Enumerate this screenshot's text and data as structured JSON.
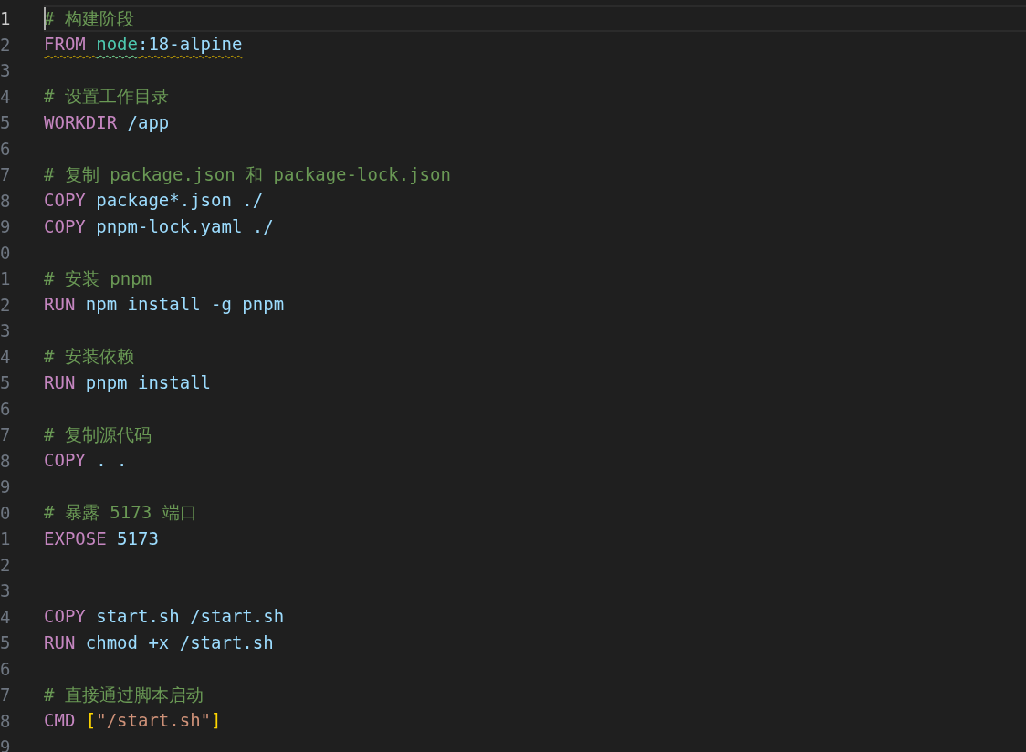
{
  "editor": {
    "lines": [
      {
        "number": "1",
        "current": true,
        "tokens": [
          {
            "kind": "comment",
            "text": "# 构建阶段"
          }
        ]
      },
      {
        "number": "2",
        "current": false,
        "warning": true,
        "tokens": [
          {
            "kind": "keyword",
            "text": "FROM "
          },
          {
            "kind": "image",
            "text": "node"
          },
          {
            "kind": "plain",
            "text": ":18-alpine"
          }
        ]
      },
      {
        "number": "3",
        "current": false
      },
      {
        "number": "4",
        "current": false,
        "tokens": [
          {
            "kind": "comment",
            "text": "# 设置工作目录"
          }
        ]
      },
      {
        "number": "5",
        "current": false,
        "tokens": [
          {
            "kind": "keyword",
            "text": "WORKDIR "
          },
          {
            "kind": "plain",
            "text": "/app"
          }
        ]
      },
      {
        "number": "6",
        "current": false
      },
      {
        "number": "7",
        "current": false,
        "tokens": [
          {
            "kind": "comment",
            "text": "# 复制 package.json 和 package-lock.json"
          }
        ]
      },
      {
        "number": "8",
        "current": false,
        "tokens": [
          {
            "kind": "keyword",
            "text": "COPY "
          },
          {
            "kind": "plain",
            "text": "package*.json ./"
          }
        ]
      },
      {
        "number": "9",
        "current": false,
        "tokens": [
          {
            "kind": "keyword",
            "text": "COPY "
          },
          {
            "kind": "plain",
            "text": "pnpm-lock.yaml ./"
          }
        ]
      },
      {
        "number": "0",
        "current": false
      },
      {
        "number": "1",
        "current": false,
        "tokens": [
          {
            "kind": "comment",
            "text": "# 安装 pnpm"
          }
        ]
      },
      {
        "number": "2",
        "current": false,
        "tokens": [
          {
            "kind": "keyword",
            "text": "RUN "
          },
          {
            "kind": "plain",
            "text": "npm install -g pnpm"
          }
        ]
      },
      {
        "number": "3",
        "current": false
      },
      {
        "number": "4",
        "current": false,
        "tokens": [
          {
            "kind": "comment",
            "text": "# 安装依赖"
          }
        ]
      },
      {
        "number": "5",
        "current": false,
        "tokens": [
          {
            "kind": "keyword",
            "text": "RUN "
          },
          {
            "kind": "plain",
            "text": "pnpm install"
          }
        ]
      },
      {
        "number": "6",
        "current": false
      },
      {
        "number": "7",
        "current": false,
        "tokens": [
          {
            "kind": "comment",
            "text": "# 复制源代码"
          }
        ]
      },
      {
        "number": "8",
        "current": false,
        "tokens": [
          {
            "kind": "keyword",
            "text": "COPY "
          },
          {
            "kind": "plain",
            "text": ". ."
          }
        ]
      },
      {
        "number": "9",
        "current": false
      },
      {
        "number": "0",
        "current": false,
        "tokens": [
          {
            "kind": "comment",
            "text": "# 暴露 5173 端口"
          }
        ]
      },
      {
        "number": "1",
        "current": false,
        "tokens": [
          {
            "kind": "keyword",
            "text": "EXPOSE "
          },
          {
            "kind": "plain",
            "text": "5173"
          }
        ]
      },
      {
        "number": "2",
        "current": false
      },
      {
        "number": "3",
        "current": false
      },
      {
        "number": "4",
        "current": false,
        "tokens": [
          {
            "kind": "keyword",
            "text": "COPY "
          },
          {
            "kind": "plain",
            "text": "start.sh /start.sh"
          }
        ]
      },
      {
        "number": "5",
        "current": false,
        "tokens": [
          {
            "kind": "keyword",
            "text": "RUN "
          },
          {
            "kind": "plain",
            "text": "chmod +x /start.sh"
          }
        ]
      },
      {
        "number": "6",
        "current": false
      },
      {
        "number": "7",
        "current": false,
        "tokens": [
          {
            "kind": "comment",
            "text": "# 直接通过脚本启动"
          }
        ]
      },
      {
        "number": "8",
        "current": false,
        "tokens": [
          {
            "kind": "keyword",
            "text": "CMD "
          },
          {
            "kind": "bracket",
            "text": "["
          },
          {
            "kind": "string",
            "text": "\"/start.sh\""
          },
          {
            "kind": "bracket",
            "text": "]"
          }
        ]
      },
      {
        "number": "9",
        "current": false
      }
    ]
  }
}
